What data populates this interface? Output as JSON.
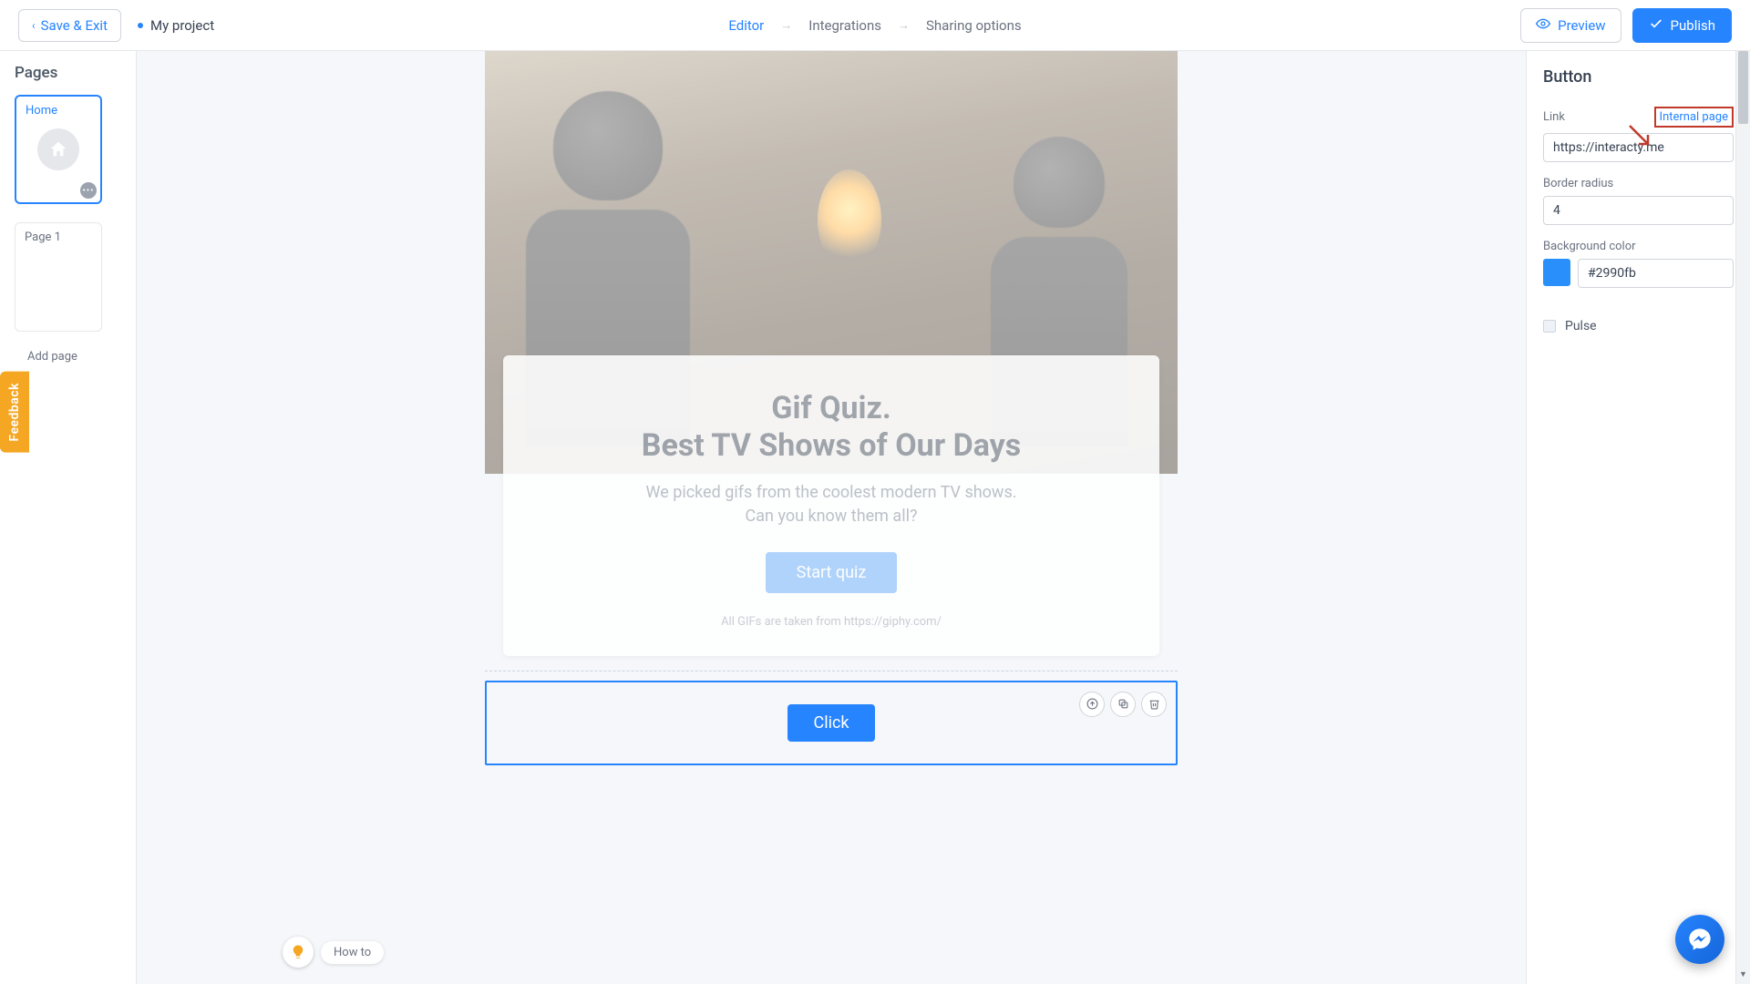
{
  "topbar": {
    "save_exit": "Save & Exit",
    "project_name": "My project",
    "steps": [
      "Editor",
      "Integrations",
      "Sharing options"
    ],
    "active_step": 0,
    "preview": "Preview",
    "publish": "Publish"
  },
  "left_panel": {
    "title": "Pages",
    "pages": [
      {
        "label": "Home",
        "active": true,
        "is_home": true
      },
      {
        "label": "Page 1",
        "active": false,
        "is_home": false
      }
    ],
    "add_page": "Add page"
  },
  "canvas": {
    "quiz_title_line1": "Gif Quiz.",
    "quiz_title_line2": "Best TV Shows of Our Days",
    "quiz_sub_line1": "We picked gifs from the coolest modern TV shows.",
    "quiz_sub_line2": "Can you know them all?",
    "start_label": "Start quiz",
    "credit": "All GIFs are taken from https://giphy.com/",
    "click_label": "Click"
  },
  "howto": {
    "label": "How to"
  },
  "right_panel": {
    "heading": "Button",
    "link_label": "Link",
    "internal_page_label": "Internal page",
    "link_value": "https://interacty.me",
    "border_label": "Border radius",
    "border_value": "4",
    "bg_label": "Background color",
    "bg_value": "#2990fb",
    "pulse_label": "Pulse",
    "pulse_checked": false
  },
  "feedback": {
    "label": "Feedback"
  },
  "icons": {
    "eye": "eye",
    "check": "check",
    "move_up": "move-up",
    "duplicate": "duplicate",
    "trash": "trash",
    "bulb": "lightbulb",
    "messenger": "messenger"
  }
}
